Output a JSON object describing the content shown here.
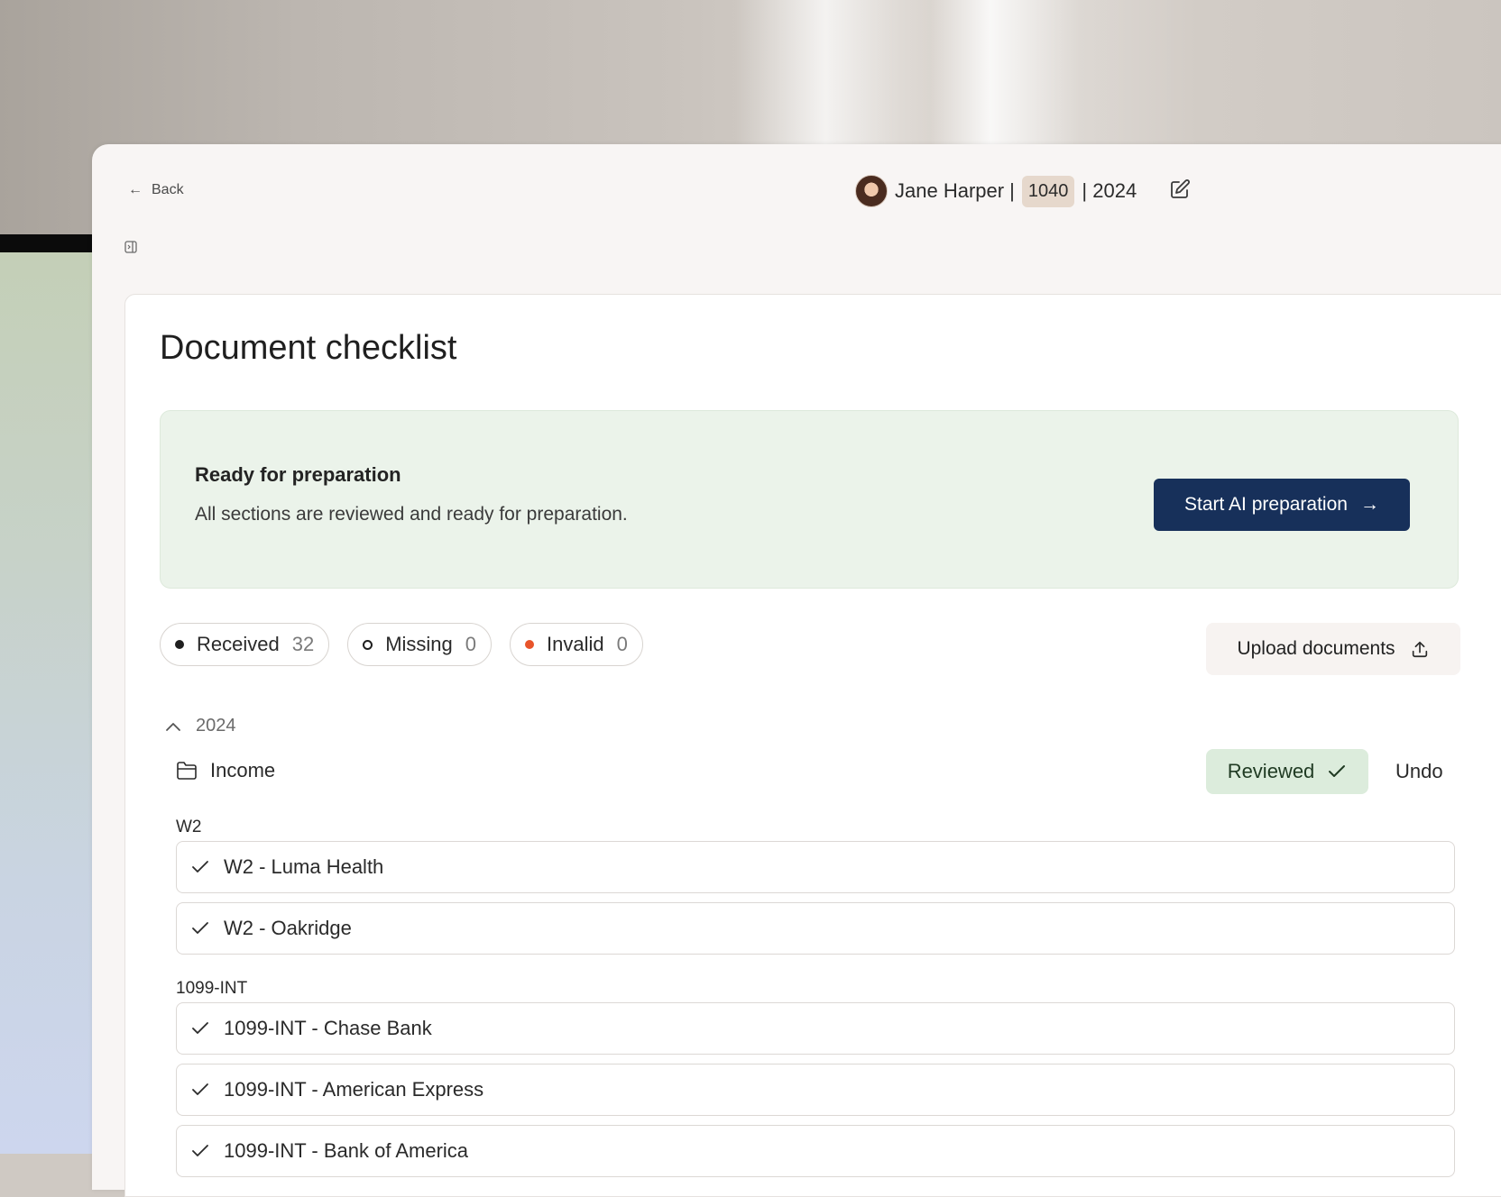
{
  "header": {
    "back_label": "Back",
    "client_name": "Jane Harper |",
    "form_type": "1040",
    "year": "| 2024"
  },
  "page": {
    "title": "Document checklist"
  },
  "ready_card": {
    "title": "Ready for preparation",
    "subtitle": "All sections are reviewed and ready for preparation.",
    "button_label": "Start AI preparation"
  },
  "filters": [
    {
      "label": "Received",
      "count": "32"
    },
    {
      "label": "Missing",
      "count": "0"
    },
    {
      "label": "Invalid",
      "count": "0"
    }
  ],
  "upload": {
    "label": "Upload documents"
  },
  "year_group": {
    "label": "2024"
  },
  "section": {
    "name": "Income",
    "status_label": "Reviewed",
    "undo_label": "Undo"
  },
  "groups": [
    {
      "label": "W2",
      "items": [
        "W2 - Luma Health",
        "W2 - Oakridge"
      ]
    },
    {
      "label": "1099-INT",
      "items": [
        "1099-INT - Chase Bank",
        "1099-INT - American Express",
        "1099-INT - Bank of America"
      ]
    }
  ],
  "colors": {
    "primary_button": "#17305a",
    "ready_bg": "#ebf3ea",
    "reviewed_bg": "#dcecdc",
    "invalid_dot": "#e8542a"
  }
}
